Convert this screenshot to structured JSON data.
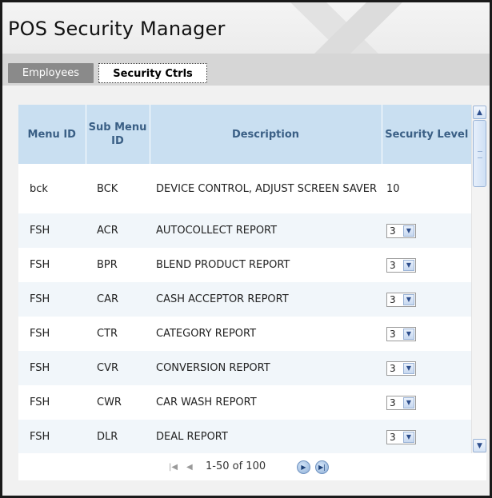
{
  "app": {
    "title": "POS Security Manager"
  },
  "tabs": [
    {
      "label": "Employees",
      "active": false
    },
    {
      "label": "Security Ctrls",
      "active": true
    }
  ],
  "table": {
    "headers": {
      "menu_id": "Menu ID",
      "sub_menu_id": "Sub Menu ID",
      "description": "Description",
      "security_level": "Security Level"
    },
    "rows": [
      {
        "menu_id": "bck",
        "sub_menu_id": "BCK",
        "description": "DEVICE CONTROL, ADJUST SCREEN SAVER",
        "level": "10",
        "editable": false
      },
      {
        "menu_id": "FSH",
        "sub_menu_id": "ACR",
        "description": "AUTOCOLLECT REPORT",
        "level": "3",
        "editable": true
      },
      {
        "menu_id": "FSH",
        "sub_menu_id": "BPR",
        "description": "BLEND PRODUCT REPORT",
        "level": "3",
        "editable": true
      },
      {
        "menu_id": "FSH",
        "sub_menu_id": "CAR",
        "description": "CASH ACCEPTOR REPORT",
        "level": "3",
        "editable": true
      },
      {
        "menu_id": "FSH",
        "sub_menu_id": "CTR",
        "description": "CATEGORY REPORT",
        "level": "3",
        "editable": true
      },
      {
        "menu_id": "FSH",
        "sub_menu_id": "CVR",
        "description": "CONVERSION REPORT",
        "level": "3",
        "editable": true
      },
      {
        "menu_id": "FSH",
        "sub_menu_id": "CWR",
        "description": "CAR WASH REPORT",
        "level": "3",
        "editable": true
      },
      {
        "menu_id": "FSH",
        "sub_menu_id": "DLR",
        "description": "DEAL REPORT",
        "level": "3",
        "editable": true
      }
    ]
  },
  "pager": {
    "text": "1-50 of 100",
    "icons": [
      "first-page-icon",
      "prev-page-icon",
      "next-page-icon",
      "last-page-icon"
    ]
  },
  "colors": {
    "header_bg": "#c9dff1",
    "header_text": "#3a5f85",
    "alt_row": "#f1f6fa",
    "tab_inactive": "#8a8a8a",
    "tabbar_bg": "#d6d6d6"
  }
}
